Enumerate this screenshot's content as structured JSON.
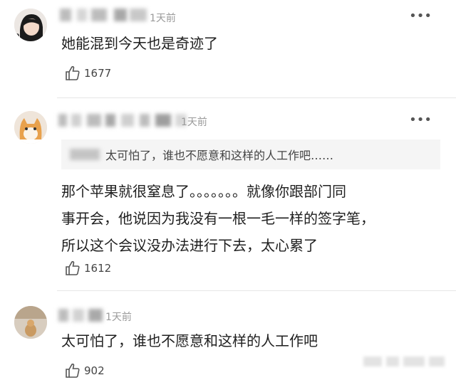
{
  "comments": [
    {
      "timestamp": "1天前",
      "text": "她能混到今天也是奇迹了",
      "likes": "1677"
    },
    {
      "timestamp": "1天前",
      "quote": "太可怕了，谁也不愿意和这样的人工作吧……",
      "text_lines": [
        "那个苹果就很窒息了。。。。。。。就像你跟部门同",
        "事开会，他说因为我没有一根一毛一样的签字笔，",
        "所以这个会议没办法进行下去，太心累了"
      ],
      "likes": "1612"
    },
    {
      "timestamp": "1天前",
      "text": "太可怕了，谁也不愿意和这样的人工作吧",
      "likes": "902"
    }
  ],
  "icons": {
    "like": "thumbs-up-icon",
    "more": "more-options-icon"
  },
  "colors": {
    "text": "#1f1f1f",
    "meta": "#9a9a9a",
    "quote_bg": "#f5f5f5"
  }
}
